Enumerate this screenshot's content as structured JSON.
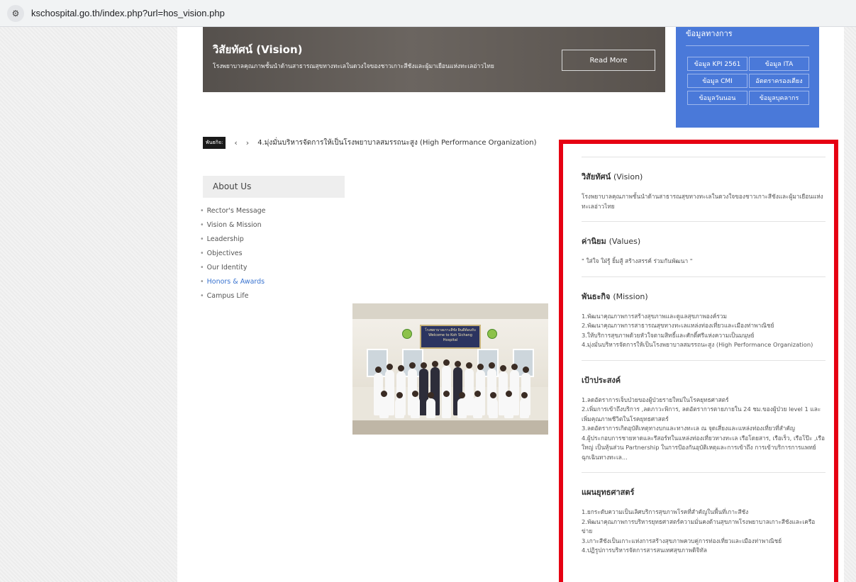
{
  "browser": {
    "url": "kschospital.go.th/index.php?url=hos_vision.php"
  },
  "hero": {
    "title": "วิสัยทัศน์ (Vision)",
    "subtitle": "โรงพยาบาลคุณภาพชั้นนำด้านสาธารณสุขทางทะเลในดวงใจของชาวเกาะสีชังและผู้มาเยือนแห่งทะเลอ่าวไทย",
    "button": "Read More"
  },
  "infobox": {
    "title": "ข้อมูลทางการ",
    "buttons": [
      "ข้อมูล KPI 2561",
      "ข้อมูล ITA",
      "ข้อมูล CMI",
      "อัตตราครองเตียง",
      "ข้อมูลวันนอน",
      "ข้อมูลบุคลากร"
    ]
  },
  "ticker": {
    "label": "พันธกิจ:",
    "prev": "‹",
    "next": "›",
    "text": "4.มุ่งมั่นบริหารจัดการให้เป็นโรงพยาบาลสมรรถนะสูง (High Performance Organization)"
  },
  "about": {
    "title": "About Us",
    "items": [
      "Rector's Message",
      "Vision & Mission",
      "Leadership",
      "Objectives",
      "Our Identity",
      "Honors & Awards",
      "Campus Life"
    ],
    "active_index": 5
  },
  "photo": {
    "sign_text": "โรงพยาบาลเกาะสีชัง ยินดีต้อนรับ Welcome to Koh Sichang Hospital"
  },
  "panel": {
    "sections": [
      {
        "title": "วิสัยทัศน์",
        "title_en": "(Vision)",
        "lines": [
          "โรงพยาบาลคุณภาพชั้นนำด้านสาธารณสุขทางทะเลในดวงใจของชาวเกาะสีชังและผู้มาเยือนแห่งทะเลอ่าวไทย"
        ]
      },
      {
        "title": "ค่านิยม",
        "title_en": "(Values)",
        "lines": [
          "\" ใส่ใจ ใฝ่รู้ ยิ้มสู้ สร้างสรรค์ ร่วมกันพัฒนา \""
        ]
      },
      {
        "title": "พันธะกิจ",
        "title_en": "(Mission)",
        "lines": [
          "1.พัฒนาคุณภาพการสร้างสุขภาพและดูแลสุขภาพองค์รวม",
          "2.พัฒนาคุณภาพการสาธารณสุขทางทะเลแหล่งท่องเที่ยวและเมืองท่าพาณิชย์",
          "3.ให้บริการสุขภาพด้วยหัวใจตามสิทธิ์และศักดิ์ศรีแห่งความเป็นมนุษย์",
          "4.มุ่งมั่นบริหารจัดการให้เป็นโรงพยาบาลสมรรถนะสูง (High Performance Organization)"
        ]
      },
      {
        "title": "เป้าประสงค์",
        "title_en": "",
        "lines": [
          "1.ลดอัตราการเจ็บป่วยของผู้ป่วยรายใหม่ในโรคยุทธศาสตร์",
          "2.เพิ่มการเข้าถึงบริการ ,ลดภาวะพิการ, ลดอัตราการตายภายใน 24 ชม.ของผู้ป่วย level 1 และเพิ่มคุณภาพชีวิตในโรคยุทธศาสตร์",
          "3.ลดอัตราการเกิดอุบัติเหตุทางบกและทางทะเล ณ จุดเสี่ยงและแหล่งท่องเที่ยวที่สำคัญ",
          "4.ผู้ประกอบการชายหาดและรีสอร์ทในแหล่งท่องเที่ยวทางทะเล เรือโดยสาร, เรือเร็ว, เรือโป๊ะ ,เรือใหญ่ เป็นหุ้นส่วน Partnership ในการป้องกันอุบัติเหตุและการเข้าถึง การเข้าบริการการแพทย์ฉุกเฉินทางทะเล..."
        ]
      },
      {
        "title": "แผนยุทธศาสตร์",
        "title_en": "",
        "lines": [
          "1.ยกระดับความเป็นเลิศบริการสุขภาพโรคที่สำคัญในพื้นที่เกาะสีชัง",
          "2.พัฒนาคุณภาพการบริหารยุทธศาสตร์ความมั่นคงด้านสุขภาพโรงพยาบาลเกาะสีชังและเครือข่าย",
          "3.เกาะสีชังเป็นเกาะแห่งการสร้างสุขภาพควบคู่การท่องเที่ยวและเมืองท่าพาณิชย์",
          "4.ปฏิรูปการบริหารจัดการสารสนเทศสุขภาพดิจิทัล"
        ]
      }
    ]
  },
  "colors": {
    "highlight_border": "#e60012",
    "infobox_bg": "#4a79d9",
    "link_active": "#3a74d0"
  }
}
